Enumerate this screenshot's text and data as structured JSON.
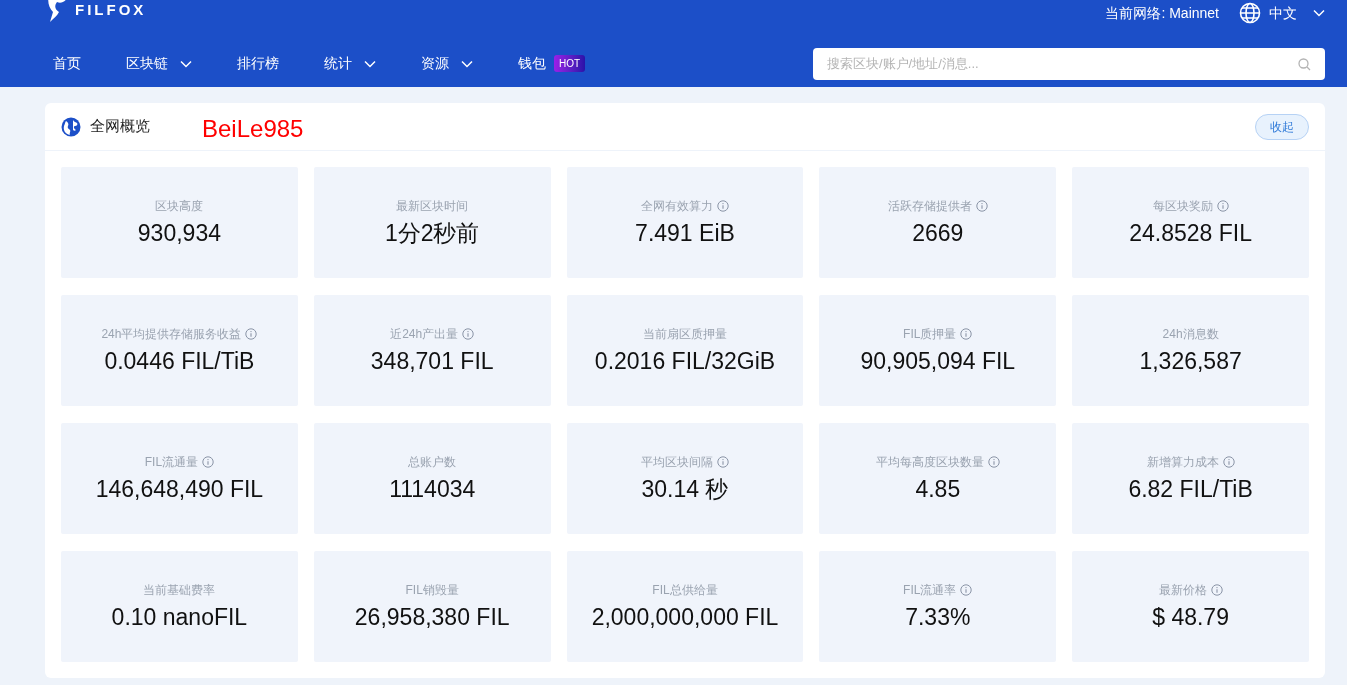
{
  "header": {
    "logo": "FILFOX",
    "network": "当前网络: Mainnet",
    "language": "中文",
    "nav": [
      {
        "label": "首页",
        "dropdown": false
      },
      {
        "label": "区块链",
        "dropdown": true
      },
      {
        "label": "排行榜",
        "dropdown": false
      },
      {
        "label": "统计",
        "dropdown": true
      },
      {
        "label": "资源",
        "dropdown": true
      },
      {
        "label": "钱包",
        "dropdown": false,
        "badge": "HOT"
      }
    ],
    "search": {
      "placeholder": "搜索区块/账户/地址/消息..."
    }
  },
  "overview": {
    "title": "全网概览",
    "annotation": "BeiLe985",
    "collapse_button": "收起",
    "stats": [
      {
        "label": "区块高度",
        "value": "930,934",
        "info": false
      },
      {
        "label": "最新区块时间",
        "value": "1分2秒前",
        "info": false
      },
      {
        "label": "全网有效算力",
        "value": "7.491 EiB",
        "info": true
      },
      {
        "label": "活跃存储提供者",
        "value": "2669",
        "info": true
      },
      {
        "label": "每区块奖励",
        "value": "24.8528 FIL",
        "info": true
      },
      {
        "label": "24h平均提供存储服务收益",
        "value": "0.0446 FIL/TiB",
        "info": true
      },
      {
        "label": "近24h产出量",
        "value": "348,701 FIL",
        "info": true
      },
      {
        "label": "当前扇区质押量",
        "value": "0.2016 FIL/32GiB",
        "info": false
      },
      {
        "label": "FIL质押量",
        "value": "90,905,094 FIL",
        "info": true
      },
      {
        "label": "24h消息数",
        "value": "1,326,587",
        "info": false
      },
      {
        "label": "FIL流通量",
        "value": "146,648,490 FIL",
        "info": true
      },
      {
        "label": "总账户数",
        "value": "1114034",
        "info": false
      },
      {
        "label": "平均区块间隔",
        "value": "30.14 秒",
        "info": true
      },
      {
        "label": "平均每高度区块数量",
        "value": "4.85",
        "info": true
      },
      {
        "label": "新增算力成本",
        "value": "6.82 FIL/TiB",
        "info": true
      },
      {
        "label": "当前基础费率",
        "value": "0.10 nanoFIL",
        "info": false
      },
      {
        "label": "FIL销毁量",
        "value": "26,958,380 FIL",
        "info": false
      },
      {
        "label": "FIL总供给量",
        "value": "2,000,000,000 FIL",
        "info": false
      },
      {
        "label": "FIL流通率",
        "value": "7.33%",
        "info": true
      },
      {
        "label": "最新价格",
        "value": "$ 48.79",
        "info": true
      }
    ]
  }
}
